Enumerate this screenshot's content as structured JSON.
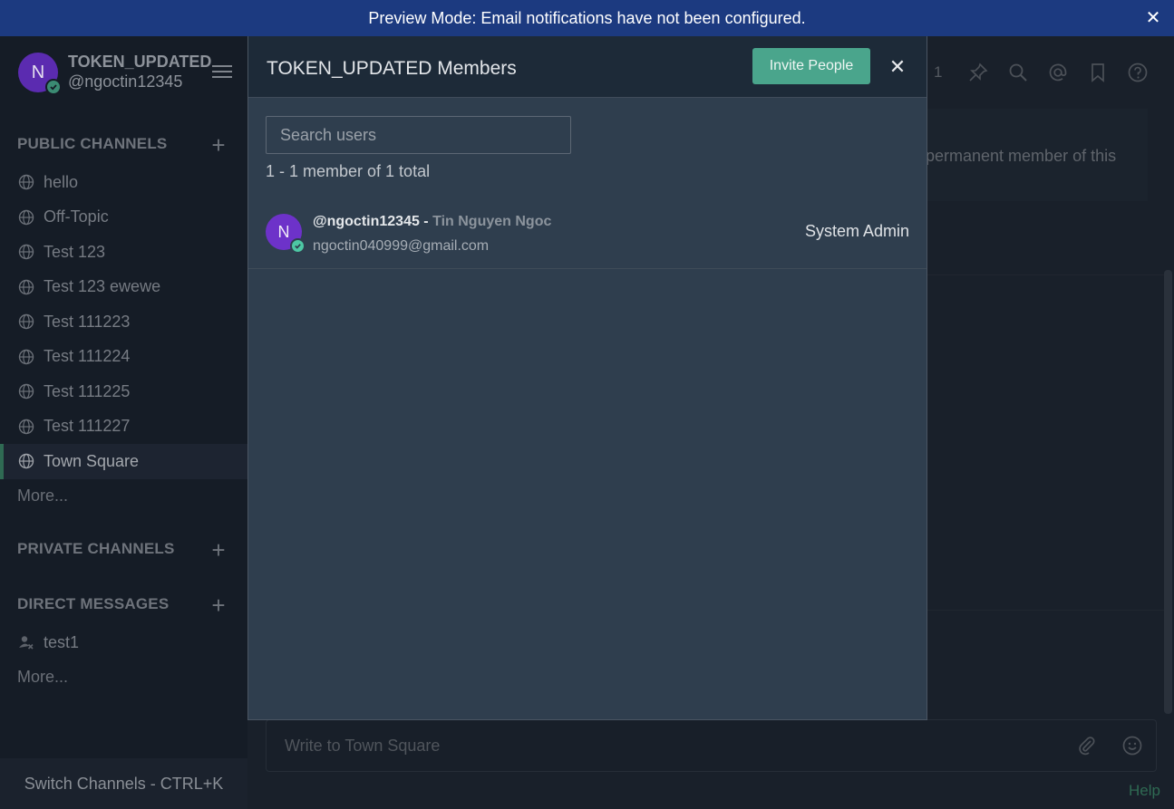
{
  "banner": {
    "text": "Preview Mode: Email notifications have not been configured."
  },
  "team": {
    "initial": "N",
    "name": "TOKEN_UPDATED",
    "username": "@ngoctin12345"
  },
  "sidebar": {
    "public_title": "PUBLIC CHANNELS",
    "public_channels": [
      {
        "label": "hello"
      },
      {
        "label": "Off-Topic"
      },
      {
        "label": "Test 123"
      },
      {
        "label": "Test 123 ewewe"
      },
      {
        "label": "Test 111223"
      },
      {
        "label": "Test 111224"
      },
      {
        "label": "Test 111225"
      },
      {
        "label": "Test 111227"
      },
      {
        "label": "Town Square"
      }
    ],
    "public_more": "More...",
    "private_title": "PRIVATE CHANNELS",
    "direct_title": "DIRECT MESSAGES",
    "direct_messages": [
      {
        "label": "test1"
      }
    ],
    "direct_more": "More...",
    "switch_label": "Switch Channels - CTRL+K"
  },
  "main": {
    "member_count_icon": "1",
    "intro_text": "permanent member of this",
    "composer_placeholder": "Write to Town Square",
    "help": "Help"
  },
  "modal": {
    "title": "TOKEN_UPDATED Members",
    "invite_label": "Invite People",
    "search_placeholder": "Search users",
    "count_text": "1 - 1 member of 1 total",
    "members": [
      {
        "initial": "N",
        "username": "@ngoctin12345 -",
        "fullname": "Tin Nguyen Ngoc",
        "email": "ngoctin040999@gmail.com",
        "role": "System Admin"
      }
    ]
  },
  "colors": {
    "banner": "#1c3a80",
    "accent": "#4aa58c",
    "avatar": "#6d32c9",
    "online": "#4dc7a4"
  }
}
